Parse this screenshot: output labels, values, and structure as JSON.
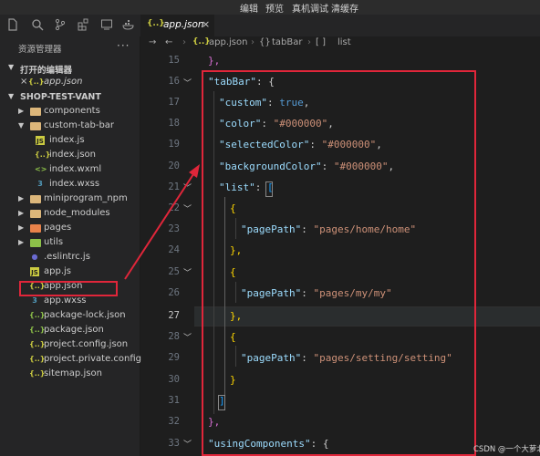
{
  "menubar": {
    "items": [
      "编辑",
      "预览",
      "真机调试",
      "清缓存"
    ]
  },
  "activity_icons": [
    "files-icon",
    "search-icon",
    "source-control-icon",
    "extensions-icon",
    "remote-icon",
    "docker-icon"
  ],
  "sidebar": {
    "title": "资源管理器",
    "more": "···",
    "open_editors": {
      "label": "打开的编辑器",
      "items": [
        {
          "close": "×",
          "icon": "{..}",
          "name": "app.json"
        }
      ]
    },
    "project": {
      "label": "SHOP-TEST-VANT",
      "tree": [
        {
          "name": "components"
        },
        {
          "name": "custom-tab-bar"
        },
        {
          "name": "index.js",
          "icon": "JS"
        },
        {
          "name": "index.json",
          "icon": "{..}"
        },
        {
          "name": "index.wxml",
          "icon": "<>"
        },
        {
          "name": "index.wxss",
          "icon": "3"
        },
        {
          "name": "miniprogram_npm"
        },
        {
          "name": "node_modules"
        },
        {
          "name": "pages"
        },
        {
          "name": "utils"
        },
        {
          "name": ".eslintrc.js",
          "icon": "●"
        },
        {
          "name": "app.js",
          "icon": "JS"
        },
        {
          "name": "app.json",
          "icon": "{..}"
        },
        {
          "name": "app.wxss",
          "icon": "3"
        },
        {
          "name": "package-lock.json",
          "icon": "{..}"
        },
        {
          "name": "package.json",
          "icon": "{..}"
        },
        {
          "name": "project.config.json",
          "icon": "{..}"
        },
        {
          "name": "project.private.config.js...",
          "icon": "{..}"
        },
        {
          "name": "sitemap.json",
          "icon": "{..}"
        }
      ]
    }
  },
  "tab": {
    "icon": "{..}",
    "label": "app.json",
    "close": "×"
  },
  "breadcrumb": {
    "icon": "{..}",
    "file": "app.json",
    "sep": "›",
    "obj_icon": "{}",
    "obj": "tabBar",
    "arr_icon": "[ ]",
    "arr": "list"
  },
  "editor": {
    "current_line": 27,
    "line_numbers": [
      15,
      16,
      17,
      18,
      19,
      20,
      21,
      22,
      23,
      24,
      25,
      26,
      27,
      28,
      29,
      30,
      31,
      32,
      33
    ],
    "code": {
      "l15_close": "},",
      "l16_key": "\"tabBar\"",
      "l16_rest": ": {",
      "l17_key": "\"custom\"",
      "l17_colon": ": ",
      "l17_val": "true",
      "l17_comma": ",",
      "l18_key": "\"color\"",
      "l18_colon": ": ",
      "l18_val": "\"#000000\"",
      "l18_comma": ",",
      "l19_key": "\"selectedColor\"",
      "l19_colon": ": ",
      "l19_val": "\"#000000\"",
      "l19_comma": ",",
      "l20_key": "\"backgroundColor\"",
      "l20_colon": ": ",
      "l20_val": "\"#000000\"",
      "l20_comma": ",",
      "l21_key": "\"list\"",
      "l21_colon": ": ",
      "l21_bracket": "[",
      "l22_brace": "{",
      "l23_key": "\"pagePath\"",
      "l23_colon": ": ",
      "l23_val": "\"pages/home/home\"",
      "l24_brace": "},",
      "l25_brace": "{",
      "l26_key": "\"pagePath\"",
      "l26_colon": ": ",
      "l26_val": "\"pages/my/my\"",
      "l27_brace": "},",
      "l28_brace": "{",
      "l29_key": "\"pagePath\"",
      "l29_colon": ": ",
      "l29_val": "\"pages/setting/setting\"",
      "l30_brace": "}",
      "l31_bracket": "]",
      "l32_close": "},",
      "l33_key": "\"usingComponents\"",
      "l33_rest": ": {"
    }
  },
  "watermark": "CSDN @一个大萝北",
  "colors": {
    "annotation_red": "#e0263a",
    "string": "#ce9178",
    "key": "#9cdcfe",
    "keyword": "#569cd6",
    "bracket_gold": "#ffd700",
    "bracket_orchid": "#da70d6",
    "bracket_blue": "#179fff"
  }
}
